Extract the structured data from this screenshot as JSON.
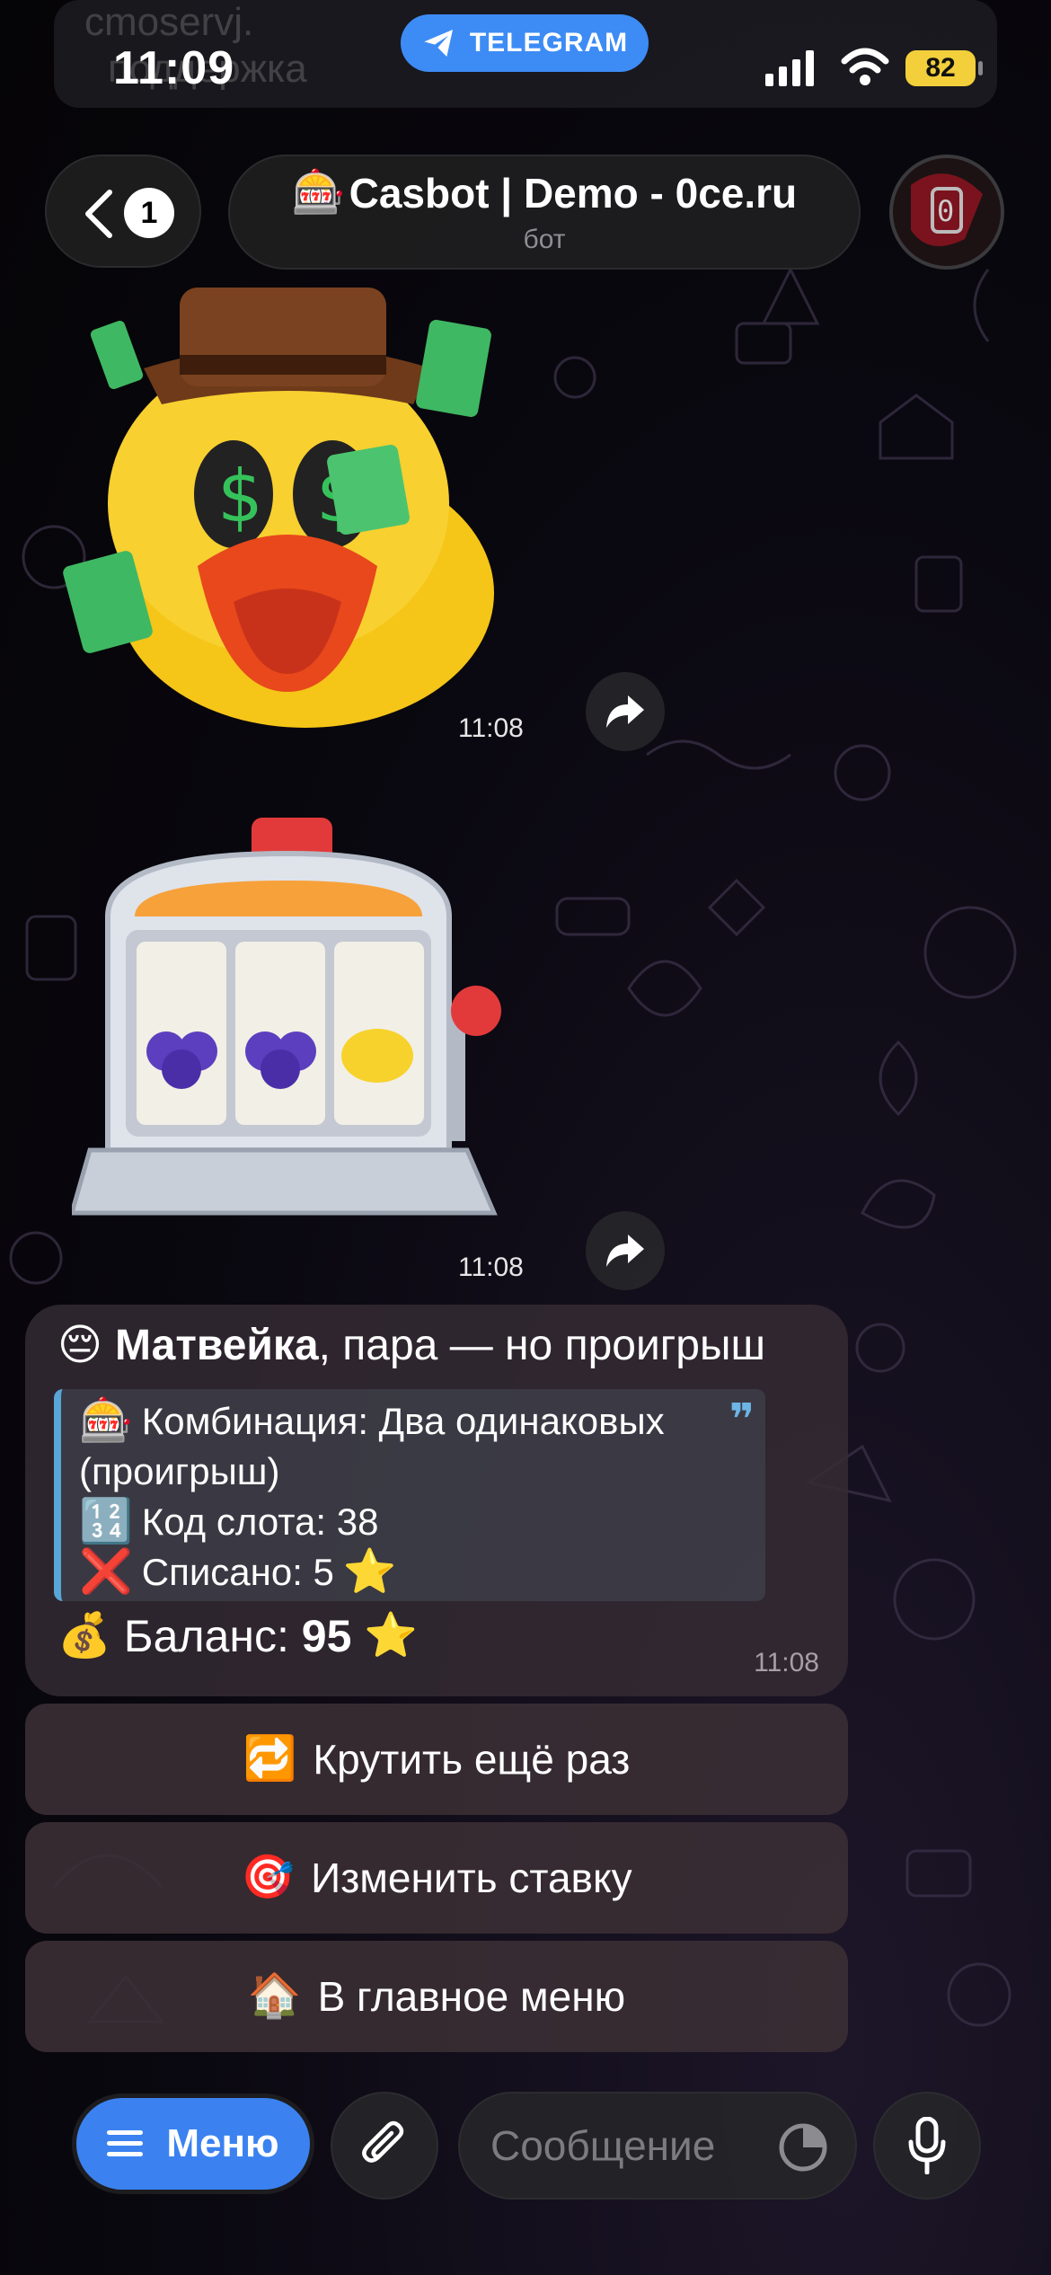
{
  "status": {
    "time": "11:09",
    "pill_label": "TELEGRAM",
    "battery": "82"
  },
  "ghost": {
    "line1": "cmoservj.",
    "line2": "поддержка"
  },
  "header": {
    "back_count": "1",
    "title_emoji": "🎰",
    "title": "Casbot | Demo - 0ce.ru",
    "subtitle": "бот",
    "avatar_glyph": "0"
  },
  "messages": {
    "sticker1_time": "11:08",
    "sticker2_time": "11:08"
  },
  "result": {
    "emoji": "😔",
    "name": "Матвейка",
    "rest": ", пара — но проигрыш",
    "quote": [
      {
        "emoji": "🎰",
        "text": "Комбинация: Два одинаковых"
      },
      {
        "emoji": "",
        "text": "(проигрыш)"
      },
      {
        "emoji": "🔢",
        "text": "Код слота: 38"
      },
      {
        "emoji": "❌",
        "text": "Списано: 5",
        "trail": "⭐"
      }
    ],
    "balance_emoji": "💰",
    "balance_label": "Баланс: ",
    "balance_value": "95",
    "balance_star": "⭐",
    "time": "11:08"
  },
  "keyboard": [
    {
      "emoji": "🔁",
      "label": "Крутить ещё раз"
    },
    {
      "emoji": "🎯",
      "label": "Изменить ставку"
    },
    {
      "emoji": "🏠",
      "label": "В главное меню"
    }
  ],
  "composer": {
    "menu_label": "Меню",
    "placeholder": "Сообщение"
  },
  "colors": {
    "accent": "#3b82f0",
    "pill": "#3d8cf5",
    "battery": "#f2cf3b",
    "quote_bar": "#58a5d6"
  }
}
